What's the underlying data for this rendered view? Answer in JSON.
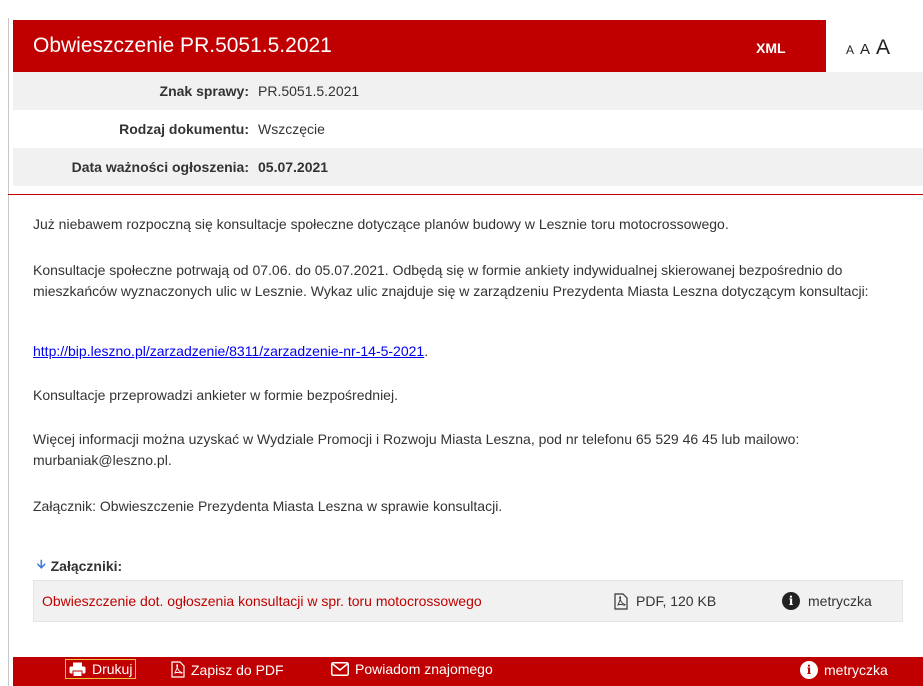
{
  "header": {
    "title": "Obwieszczenie PR.5051.5.2021",
    "xml_label": "XML",
    "font_sizes": [
      "A",
      "A",
      "A"
    ]
  },
  "meta": {
    "rows": [
      {
        "label": "Znak sprawy:",
        "value": "PR.5051.5.2021"
      },
      {
        "label": "Rodzaj dokumentu:",
        "value": "Wszczęcie"
      },
      {
        "label": "Data ważności ogłoszenia:",
        "value": "05.07.2021"
      }
    ]
  },
  "content": {
    "p1": "Już niebawem rozpoczną się konsultacje społeczne dotyczące planów budowy w Lesznie toru motocrossowego.",
    "p2": "Konsultacje społeczne potrwają od 07.06. do 05.07.2021. Odbędą się w formie ankiety indywidualnej skierowanej bezpośrednio do mieszkańców wyznaczonych ulic w Lesznie. Wykaz ulic znajduje się w zarządzeniu Prezydenta Miasta Leszna dotyczącym konsultacji:",
    "link": "http://bip.leszno.pl/zarzadzenie/8311/zarzadzenie-nr-14-5-2021",
    "link_suffix": ".",
    "p4": "Konsultacje przeprowadzi ankieter w formie bezpośredniej.",
    "p5": "Więcej informacji można uzyskać w Wydziale Promocji i Rozwoju Miasta Leszna, pod nr telefonu 65 529 46 45 lub mailowo: murbaniak@leszno.pl.",
    "p6": "Załącznik: Obwieszczenie Prezydenta Miasta Leszna w sprawie konsultacji."
  },
  "attachments": {
    "heading": "Załączniki:",
    "items": [
      {
        "name": "Obwieszczenie dot. ogłoszenia konsultacji w spr. toru motocrossowego",
        "filetype": "PDF, 120 KB",
        "meta_label": "metryczka"
      }
    ]
  },
  "footer": {
    "print_label": "Drukuj",
    "pdf_label": "Zapisz do PDF",
    "share_label": "Powiadom znajomego",
    "meta_label": "metryczka"
  },
  "colors": {
    "brand_red": "#c00000",
    "link_blue": "#0000ee",
    "row_shade": "#f1f1f1"
  }
}
